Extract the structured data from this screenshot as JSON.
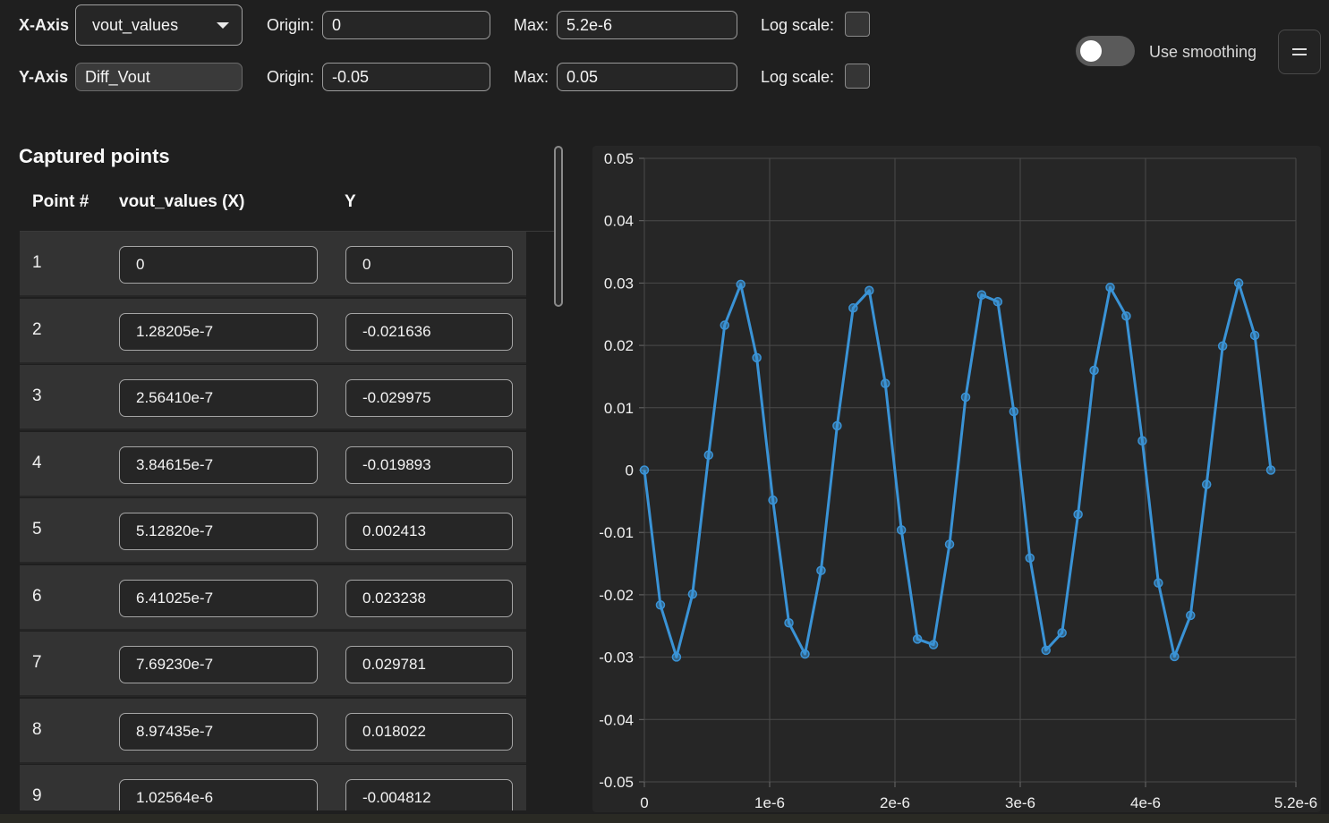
{
  "controls": {
    "x_axis": {
      "label": "X-Axis",
      "selected": "vout_values",
      "origin_label": "Origin:",
      "origin": "0",
      "max_label": "Max:",
      "max": "5.2e-6",
      "log_label": "Log scale:"
    },
    "y_axis": {
      "label": "Y-Axis",
      "value": "Diff_Vout",
      "origin_label": "Origin:",
      "origin": "-0.05",
      "max_label": "Max:",
      "max": "0.05",
      "log_label": "Log scale:"
    },
    "smoothing_label": "Use smoothing",
    "smoothing_on": false
  },
  "table": {
    "title": "Captured points",
    "headers": [
      "Point #",
      "vout_values (X)",
      "Y"
    ],
    "rows": [
      {
        "point": "1",
        "x": "0",
        "y": "0"
      },
      {
        "point": "2",
        "x": "1.28205e-7",
        "y": "-0.021636"
      },
      {
        "point": "3",
        "x": "2.56410e-7",
        "y": "-0.029975"
      },
      {
        "point": "4",
        "x": "3.84615e-7",
        "y": "-0.019893"
      },
      {
        "point": "5",
        "x": "5.12820e-7",
        "y": "0.002413"
      },
      {
        "point": "6",
        "x": "6.41025e-7",
        "y": "0.023238"
      },
      {
        "point": "7",
        "x": "7.69230e-7",
        "y": "0.029781"
      },
      {
        "point": "8",
        "x": "8.97435e-7",
        "y": "0.018022"
      },
      {
        "point": "9",
        "x": "1.02564e-6",
        "y": "-0.004812"
      }
    ]
  },
  "colors": {
    "line": "#3a93d6",
    "grid": "#4a4a4a",
    "axis": "#6a6a6a"
  },
  "chart_data": {
    "type": "line",
    "xlim": [
      0,
      5.2e-06
    ],
    "ylim": [
      -0.05,
      0.05
    ],
    "x_ticks": [
      0,
      1e-06,
      2e-06,
      3e-06,
      4e-06,
      5.2e-06
    ],
    "x_tick_labels": [
      "0",
      "1e-6",
      "2e-6",
      "3e-6",
      "4e-6",
      "5.2e-6"
    ],
    "y_ticks": [
      0.05,
      0.04,
      0.03,
      0.02,
      0.01,
      0,
      -0.01,
      -0.02,
      -0.03,
      -0.04,
      -0.05
    ],
    "y_tick_labels": [
      "0.05",
      "0.04",
      "0.03",
      "0.02",
      "0.01",
      "0",
      "-0.01",
      "-0.02",
      "-0.03",
      "-0.04",
      "-0.05"
    ],
    "grid": true,
    "x": [
      0,
      1.28205e-07,
      2.5641e-07,
      3.84615e-07,
      5.1282e-07,
      6.41025e-07,
      7.6923e-07,
      8.97435e-07,
      1.02564e-06,
      1.15385e-06,
      1.28205e-06,
      1.41026e-06,
      1.53846e-06,
      1.66667e-06,
      1.79487e-06,
      1.92308e-06,
      2.05128e-06,
      2.17949e-06,
      2.30769e-06,
      2.4359e-06,
      2.5641e-06,
      2.69231e-06,
      2.82051e-06,
      2.94872e-06,
      3.07692e-06,
      3.20513e-06,
      3.33333e-06,
      3.46154e-06,
      3.58974e-06,
      3.71795e-06,
      3.84615e-06,
      3.97436e-06,
      4.10256e-06,
      4.23077e-06,
      4.35897e-06,
      4.48718e-06,
      4.61538e-06,
      4.74359e-06,
      4.87179e-06,
      5e-06
    ],
    "y": [
      0,
      -0.021636,
      -0.029975,
      -0.019893,
      0.002413,
      0.023238,
      0.029781,
      0.018022,
      -0.004812,
      -0.0245,
      -0.0295,
      -0.0161,
      0.0071,
      0.026,
      0.0288,
      0.0139,
      -0.0096,
      -0.0271,
      -0.028,
      -0.0119,
      0.0117,
      0.0281,
      0.027,
      0.0094,
      -0.0141,
      -0.0289,
      -0.0261,
      -0.0071,
      0.016,
      0.0293,
      0.0247,
      0.0047,
      -0.0181,
      -0.0299,
      -0.0233,
      -0.0023,
      0.0199,
      0.03,
      0.0216,
      0
    ]
  }
}
